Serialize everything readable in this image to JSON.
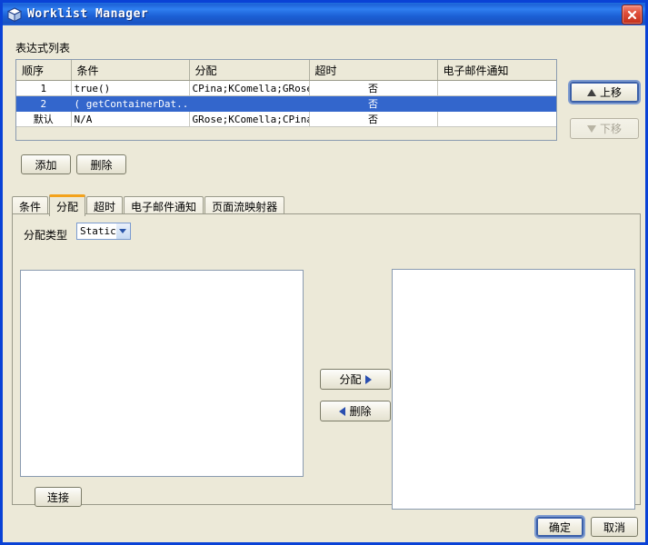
{
  "window": {
    "title": "Worklist Manager",
    "icon": "cube-icon",
    "close_label": "X",
    "accent": "#0a42d6",
    "face": "#ece9d8",
    "selection": "#3366cc",
    "tab_accent": "#f3a21b"
  },
  "section": {
    "expr_list_label": "表达式列表"
  },
  "table": {
    "columns": [
      "顺序",
      "条件",
      "分配",
      "超时",
      "电子邮件通知"
    ],
    "rows": [
      {
        "selected": false,
        "cells": [
          "1",
          "true()",
          "CPina;KComella;GRose;",
          "否",
          ""
        ]
      },
      {
        "selected": true,
        "cells": [
          "2",
          "( getContainerDat...",
          "",
          "否",
          ""
        ]
      },
      {
        "selected": false,
        "cells": [
          "默认",
          "N/A",
          "GRose;KComella;CPina;",
          "否",
          ""
        ]
      }
    ]
  },
  "side_buttons": {
    "up": {
      "label": "上移",
      "icon": "triangle-up-icon",
      "enabled": true,
      "focused": true
    },
    "down": {
      "label": "下移",
      "icon": "triangle-down-icon",
      "enabled": false,
      "focused": false
    }
  },
  "list_actions": {
    "add": "添加",
    "delete": "删除"
  },
  "tabs": [
    {
      "label": "条件",
      "active": false
    },
    {
      "label": "分配",
      "active": true
    },
    {
      "label": "超时",
      "active": false
    },
    {
      "label": "电子邮件通知",
      "active": false
    },
    {
      "label": "页面流映射器",
      "active": false
    }
  ],
  "alloc_panel": {
    "type_label": "分配类型",
    "type_value": "Static",
    "type_options": [
      "Static"
    ],
    "left_list_items": [],
    "right_list_items": [],
    "assign_button": {
      "label": "分配",
      "icon": "triangle-right-icon"
    },
    "remove_button": {
      "label": "删除",
      "icon": "triangle-left-icon"
    },
    "connect_button": "连接"
  },
  "footer": {
    "ok": "确定",
    "cancel": "取消"
  }
}
